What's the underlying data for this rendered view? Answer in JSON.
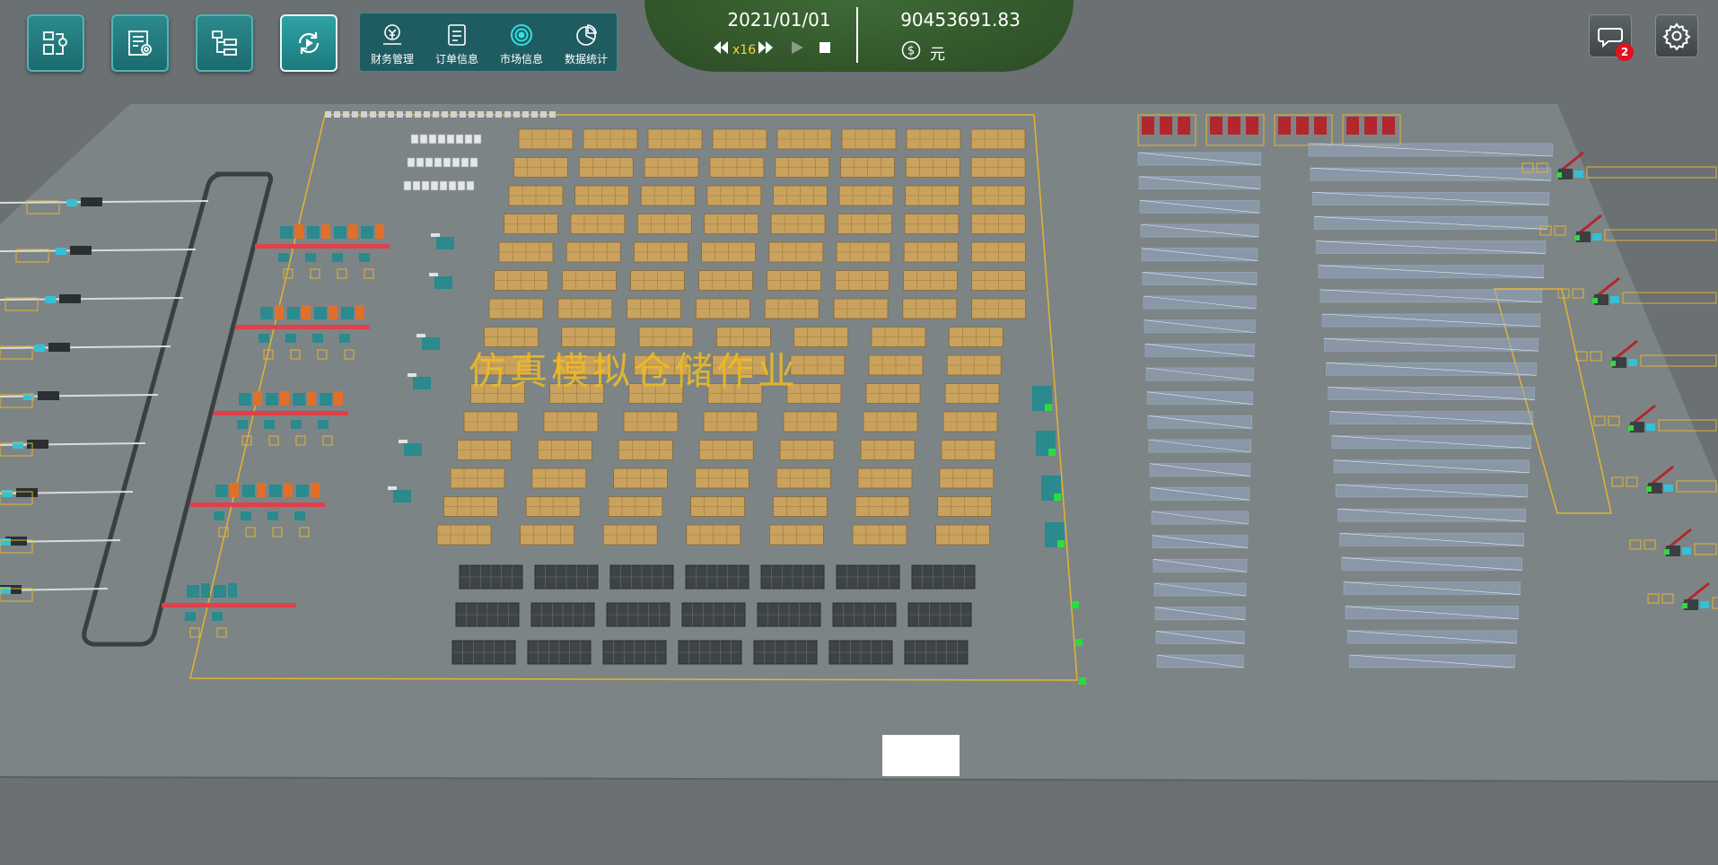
{
  "toolbar": {
    "buttons": [
      {
        "name": "scene-settings-icon",
        "active": false
      },
      {
        "name": "task-settings-icon",
        "active": false
      },
      {
        "name": "structure-tree-icon",
        "active": false
      },
      {
        "name": "simulation-play-icon",
        "active": true
      }
    ]
  },
  "menu": {
    "items": [
      {
        "label": "财务管理",
        "icon": "finance-icon"
      },
      {
        "label": "订单信息",
        "icon": "order-icon"
      },
      {
        "label": "市场信息",
        "icon": "market-icon"
      },
      {
        "label": "数据统计",
        "icon": "statistics-icon"
      }
    ]
  },
  "hud": {
    "date": "2021/01/01",
    "speed": "x16",
    "money": "90453691.83",
    "currency": "元"
  },
  "notifications": {
    "count": "2"
  },
  "scene": {
    "watermark": "仿真模拟仓储作业",
    "colors": {
      "floor": "#7d8486",
      "ground": "#6e7375",
      "box": "#c9a25e",
      "rack": "#a9c2df",
      "accent": "#2a8a8d",
      "line": "#e3b431"
    }
  }
}
